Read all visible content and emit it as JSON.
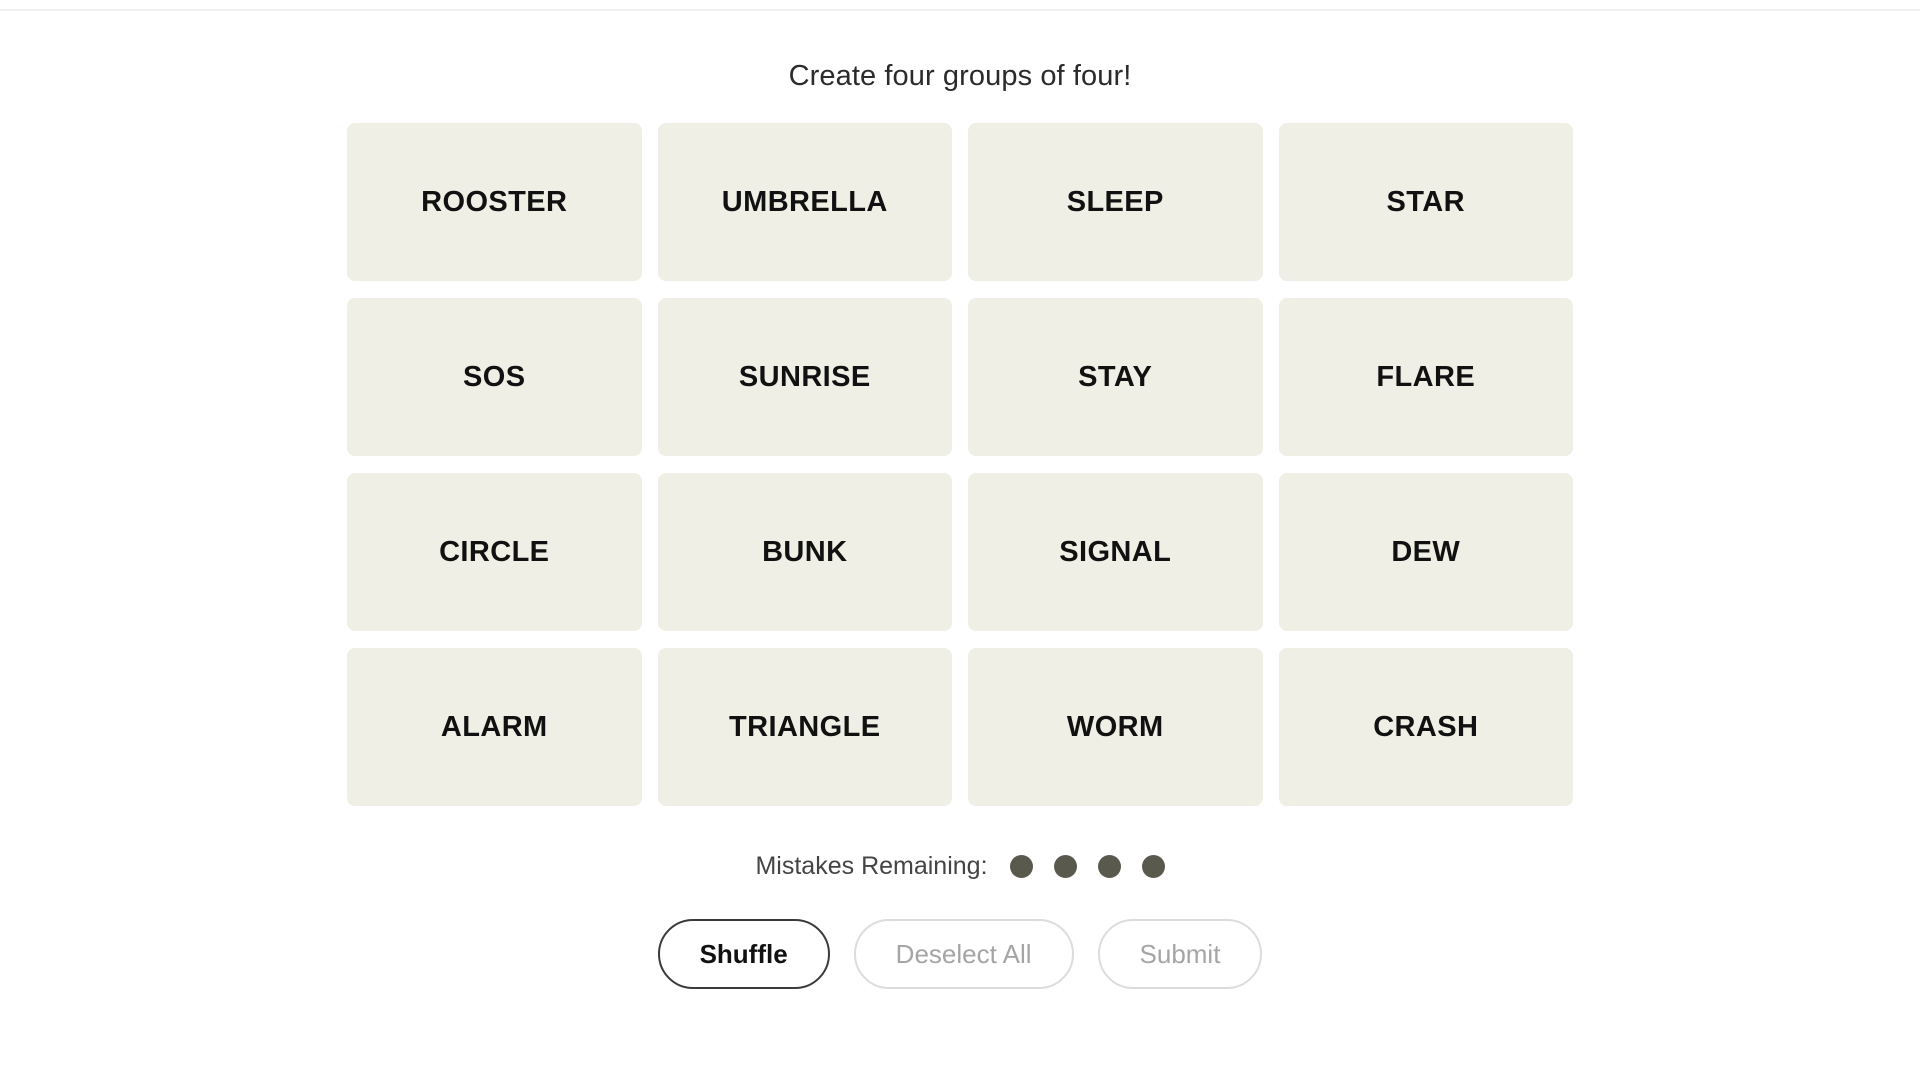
{
  "header": {
    "title": "Create four groups of four!"
  },
  "board": {
    "tiles": [
      {
        "label": "ROOSTER",
        "row": 1,
        "col": 1
      },
      {
        "label": "UMBRELLA",
        "row": 1,
        "col": 2
      },
      {
        "label": "SLEEP",
        "row": 1,
        "col": 3
      },
      {
        "label": "STAR",
        "row": 1,
        "col": 4
      },
      {
        "label": "SOS",
        "row": 2,
        "col": 1
      },
      {
        "label": "SUNRISE",
        "row": 2,
        "col": 2
      },
      {
        "label": "STAY",
        "row": 2,
        "col": 3
      },
      {
        "label": "FLARE",
        "row": 2,
        "col": 4
      },
      {
        "label": "CIRCLE",
        "row": 3,
        "col": 1
      },
      {
        "label": "BUNK",
        "row": 3,
        "col": 2
      },
      {
        "label": "SIGNAL",
        "row": 3,
        "col": 3
      },
      {
        "label": "DEW",
        "row": 3,
        "col": 4
      },
      {
        "label": "ALARM",
        "row": 4,
        "col": 1
      },
      {
        "label": "TRIANGLE",
        "row": 4,
        "col": 2
      },
      {
        "label": "WORM",
        "row": 4,
        "col": 3
      },
      {
        "label": "CRASH",
        "row": 4,
        "col": 4
      }
    ],
    "tile_color": "#EFEFE6",
    "tile_text_color": "#111111"
  },
  "mistakes": {
    "label": "Mistakes Remaining:",
    "remaining": 4,
    "dot_color": "#5A594E"
  },
  "controls": {
    "shuffle": {
      "label": "Shuffle",
      "state": "enabled"
    },
    "deselect_all": {
      "label": "Deselect All",
      "state": "disabled"
    },
    "submit": {
      "label": "Submit",
      "state": "disabled"
    }
  }
}
